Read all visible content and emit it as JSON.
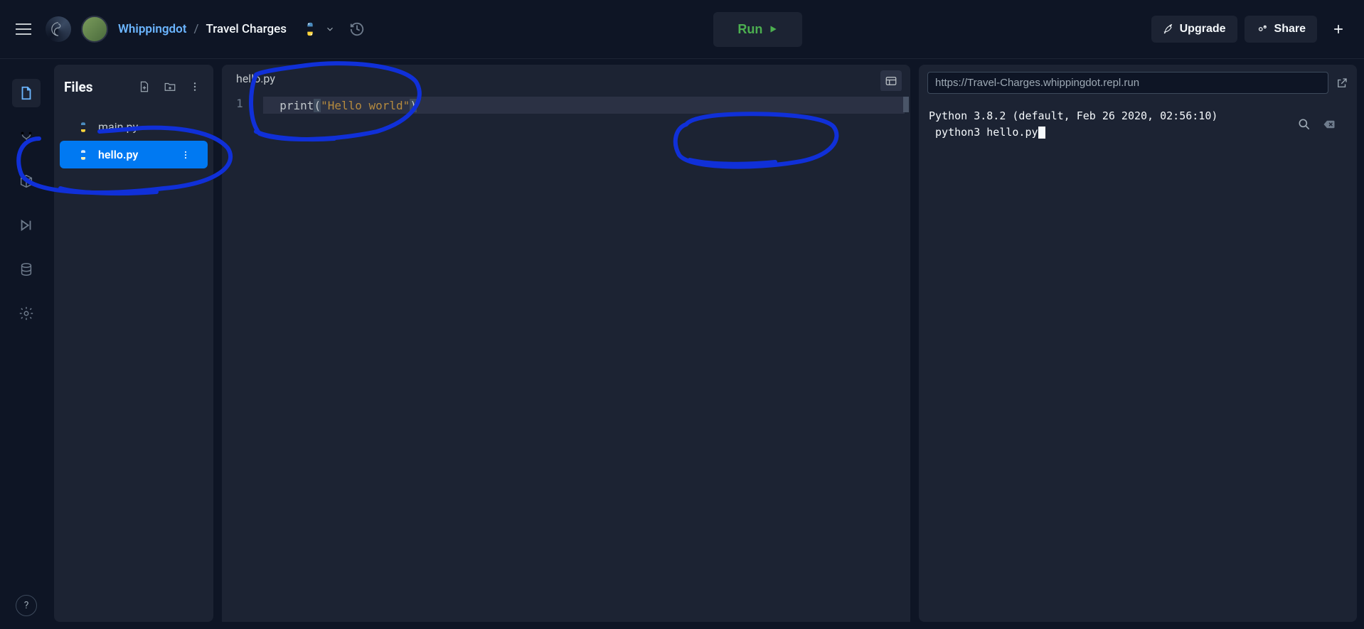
{
  "header": {
    "user": "Whippingdot",
    "separator": "/",
    "project": "Travel Charges",
    "run_label": "Run",
    "upgrade_label": "Upgrade",
    "share_label": "Share"
  },
  "files": {
    "title": "Files",
    "items": [
      {
        "name": "main.py",
        "active": false
      },
      {
        "name": "hello.py",
        "active": true
      }
    ]
  },
  "editor": {
    "tab": "hello.py",
    "line_number": "1",
    "code_fn": "print",
    "code_lp": "(",
    "code_str": "\"Hello world\"",
    "code_rp": ")"
  },
  "console": {
    "url": "https://Travel-Charges.whippingdot.repl.run",
    "line1": "Python 3.8.2 (default, Feb 26 2020, 02:56:10)",
    "prompt": "",
    "cmd": " python3 hello.py"
  }
}
